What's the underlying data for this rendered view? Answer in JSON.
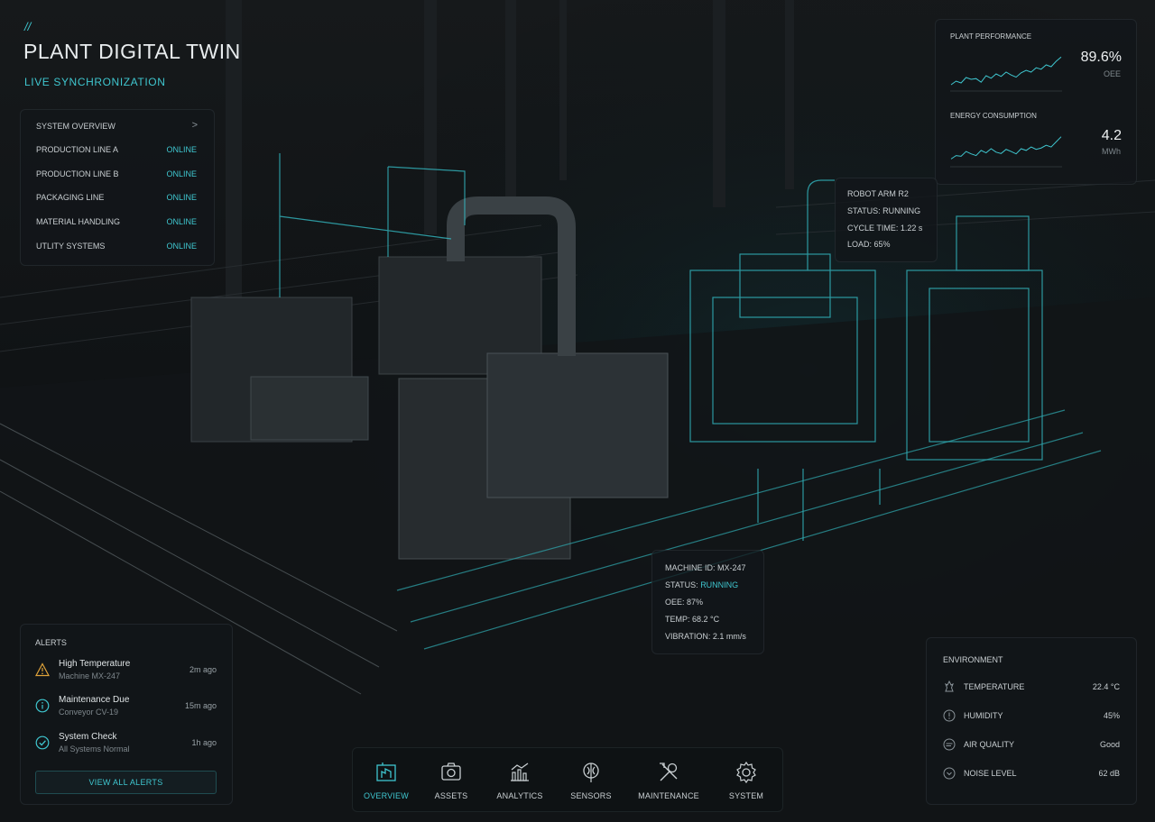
{
  "header": {
    "slash": "//",
    "title": "PLANT DIGITAL TWIN",
    "subtitle": "LIVE SYNCHRONIZATION"
  },
  "system_overview": {
    "title": "SYSTEM OVERVIEW",
    "chevron": ">",
    "items": [
      {
        "label": "PRODUCTION LINE A",
        "status": "ONLINE"
      },
      {
        "label": "PRODUCTION LINE B",
        "status": "ONLINE"
      },
      {
        "label": "PACKAGING LINE",
        "status": "ONLINE"
      },
      {
        "label": "MATERIAL HANDLING",
        "status": "ONLINE"
      },
      {
        "label": "UTLITY SYSTEMS",
        "status": "ONLINE"
      }
    ]
  },
  "performance": {
    "plant": {
      "label": "PLANT PERFORMANCE",
      "value": "89.6%",
      "unit": "OEE",
      "trend": [
        0.15,
        0.25,
        0.2,
        0.35,
        0.3,
        0.32,
        0.22,
        0.4,
        0.33,
        0.45,
        0.38,
        0.5,
        0.42,
        0.36,
        0.48,
        0.55,
        0.5,
        0.62,
        0.58,
        0.7,
        0.65,
        0.8,
        0.92
      ]
    },
    "energy": {
      "label": "ENERGY CONSUMPTION",
      "value": "4.2",
      "unit": "MWh",
      "trend": [
        0.2,
        0.3,
        0.28,
        0.42,
        0.35,
        0.3,
        0.45,
        0.38,
        0.5,
        0.4,
        0.36,
        0.48,
        0.42,
        0.35,
        0.5,
        0.45,
        0.55,
        0.48,
        0.52,
        0.6,
        0.55,
        0.7,
        0.85
      ]
    }
  },
  "robot_arm": {
    "title": "ROBOT ARM R2",
    "status": "STATUS: RUNNING",
    "cycle": "CYCLE TIME: 1.22 s",
    "load": "LOAD: 65%"
  },
  "machine": {
    "id": "MACHINE ID: MX-247",
    "status_label": "STATUS:",
    "status_value": "RUNNING",
    "oee": "OEE: 87%",
    "temp": "TEMP: 68.2 °C",
    "vibration": "VIBRATION: 2.1 mm/s"
  },
  "alerts": {
    "title": "ALERTS",
    "items": [
      {
        "title": "High Temperature",
        "sub": "Machine MX-247",
        "time": "2m ago",
        "icon": "warning-icon",
        "color": "#e0a33a"
      },
      {
        "title": "Maintenance Due",
        "sub": "Conveyor CV-19",
        "time": "15m ago",
        "icon": "info-icon",
        "color": "#3fc6cf"
      },
      {
        "title": "System Check",
        "sub": "All Systems Normal",
        "time": "1h ago",
        "icon": "check-circle-icon",
        "color": "#3fc6cf"
      }
    ],
    "view_all": "VIEW ALL ALERTS"
  },
  "environment": {
    "title": "ENVIRONMENT",
    "items": [
      {
        "label": "TEMPERATURE",
        "value": "22.4 °C",
        "icon": "thermometer-icon"
      },
      {
        "label": "HUMIDITY",
        "value": "45%",
        "icon": "humidity-icon"
      },
      {
        "label": "AIR QUALITY",
        "value": "Good",
        "icon": "air-quality-icon"
      },
      {
        "label": "NOISE LEVEL",
        "value": "62 dB",
        "icon": "noise-icon"
      }
    ]
  },
  "nav": {
    "items": [
      {
        "label": "OVERVIEW",
        "icon": "factory-icon",
        "active": true
      },
      {
        "label": "ASSETS",
        "icon": "assets-icon",
        "active": false
      },
      {
        "label": "ANALYTICS",
        "icon": "analytics-icon",
        "active": false
      },
      {
        "label": "SENSORS",
        "icon": "sensor-icon",
        "active": false
      },
      {
        "label": "MAINTENANCE",
        "icon": "wrench-icon",
        "active": false
      },
      {
        "label": "SYSTEM",
        "icon": "gear-icon",
        "active": false
      }
    ]
  },
  "colors": {
    "accent": "#3fc6cf",
    "warning": "#e0a33a",
    "background": "#0b0e10"
  }
}
